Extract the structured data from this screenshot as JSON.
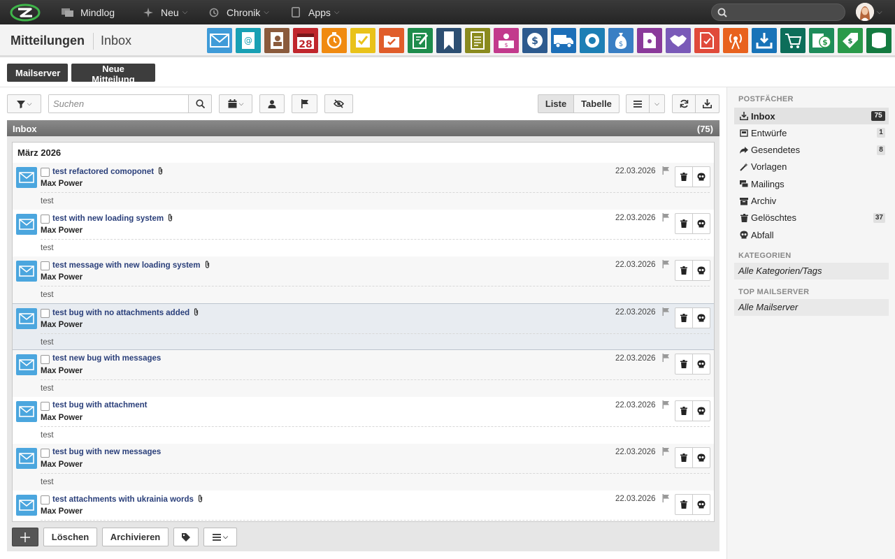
{
  "topbar": {
    "nav": [
      {
        "label": "Mindlog",
        "icon": "mindlog-icon"
      },
      {
        "label": "Neu",
        "icon": "sparkle-icon"
      },
      {
        "label": "Chronik",
        "icon": "history-icon"
      },
      {
        "label": "Apps",
        "icon": "tablet-icon"
      }
    ],
    "search_placeholder": ""
  },
  "header": {
    "title": "Mitteilungen",
    "subtitle": "Inbox"
  },
  "app_colors": [
    "#3f9bd8",
    "#19a0b4",
    "#8a5a3c",
    "#c0262c",
    "#f08a10",
    "#e9c21a",
    "#e05d2a",
    "#1e8c4c",
    "#2d4f72",
    "#8a8a1e",
    "#c23a8c",
    "#2d5a8e",
    "#1d6fb8",
    "#1d7fb5",
    "#3a7fc4",
    "#8a3a9a",
    "#7a5ab8",
    "#e04a3a",
    "#e8621e",
    "#1873b8",
    "#0d6e5a",
    "#1e8c5a",
    "#2a9a4a",
    "#147a40"
  ],
  "actions": {
    "mailserver": "Mailserver",
    "new_message": "Neue Mitteilung"
  },
  "toolbar": {
    "search_placeholder": "Suchen",
    "view_list": "Liste",
    "view_table": "Tabelle"
  },
  "panel": {
    "title": "Inbox",
    "count": "(75)",
    "month": "März 2026"
  },
  "messages": [
    {
      "subject": "test refactored comoponet",
      "from": "Max Power",
      "preview": "test",
      "date": "22.03.2026",
      "attachment": true
    },
    {
      "subject": "test with new loading system",
      "from": "Max Power",
      "preview": "test",
      "date": "22.03.2026",
      "attachment": true
    },
    {
      "subject": "test message with new loading system",
      "from": "Max Power",
      "preview": "test",
      "date": "22.03.2026",
      "attachment": true
    },
    {
      "subject": "test bug with no attachments added",
      "from": "Max Power",
      "preview": "test",
      "date": "22.03.2026",
      "attachment": true
    },
    {
      "subject": "test new bug with messages",
      "from": "Max Power",
      "preview": "test",
      "date": "22.03.2026",
      "attachment": false
    },
    {
      "subject": "test bug with attachment",
      "from": "Max Power",
      "preview": "test",
      "date": "22.03.2026",
      "attachment": false
    },
    {
      "subject": "test bug with new messages",
      "from": "Max Power",
      "preview": "test",
      "date": "22.03.2026",
      "attachment": false
    },
    {
      "subject": "test attachments with ukrainia words",
      "from": "Max Power",
      "preview": "",
      "date": "22.03.2026",
      "attachment": true
    }
  ],
  "bottom": {
    "delete": "Löschen",
    "archive": "Archivieren"
  },
  "sidebar": {
    "postfaecher_title": "POSTFÄCHER",
    "items": [
      {
        "label": "Inbox",
        "count": "75",
        "icon": "download-icon"
      },
      {
        "label": "Entwürfe",
        "count": "1",
        "icon": "drafts-icon"
      },
      {
        "label": "Gesendetes",
        "count": "8",
        "icon": "share-icon"
      },
      {
        "label": "Vorlagen",
        "count": "",
        "icon": "magic-wand-icon"
      },
      {
        "label": "Mailings",
        "count": "",
        "icon": "mailings-icon"
      },
      {
        "label": "Archiv",
        "count": "",
        "icon": "archive-icon"
      },
      {
        "label": "Gelöschtes",
        "count": "37",
        "icon": "trash-icon"
      },
      {
        "label": "Abfall",
        "count": "",
        "icon": "skull-icon"
      }
    ],
    "categories_title": "KATEGORIEN",
    "categories_all": "Alle Kategorien/Tags",
    "mailserver_title": "TOP MAILSERVER",
    "mailserver_all": "Alle Mailserver"
  }
}
